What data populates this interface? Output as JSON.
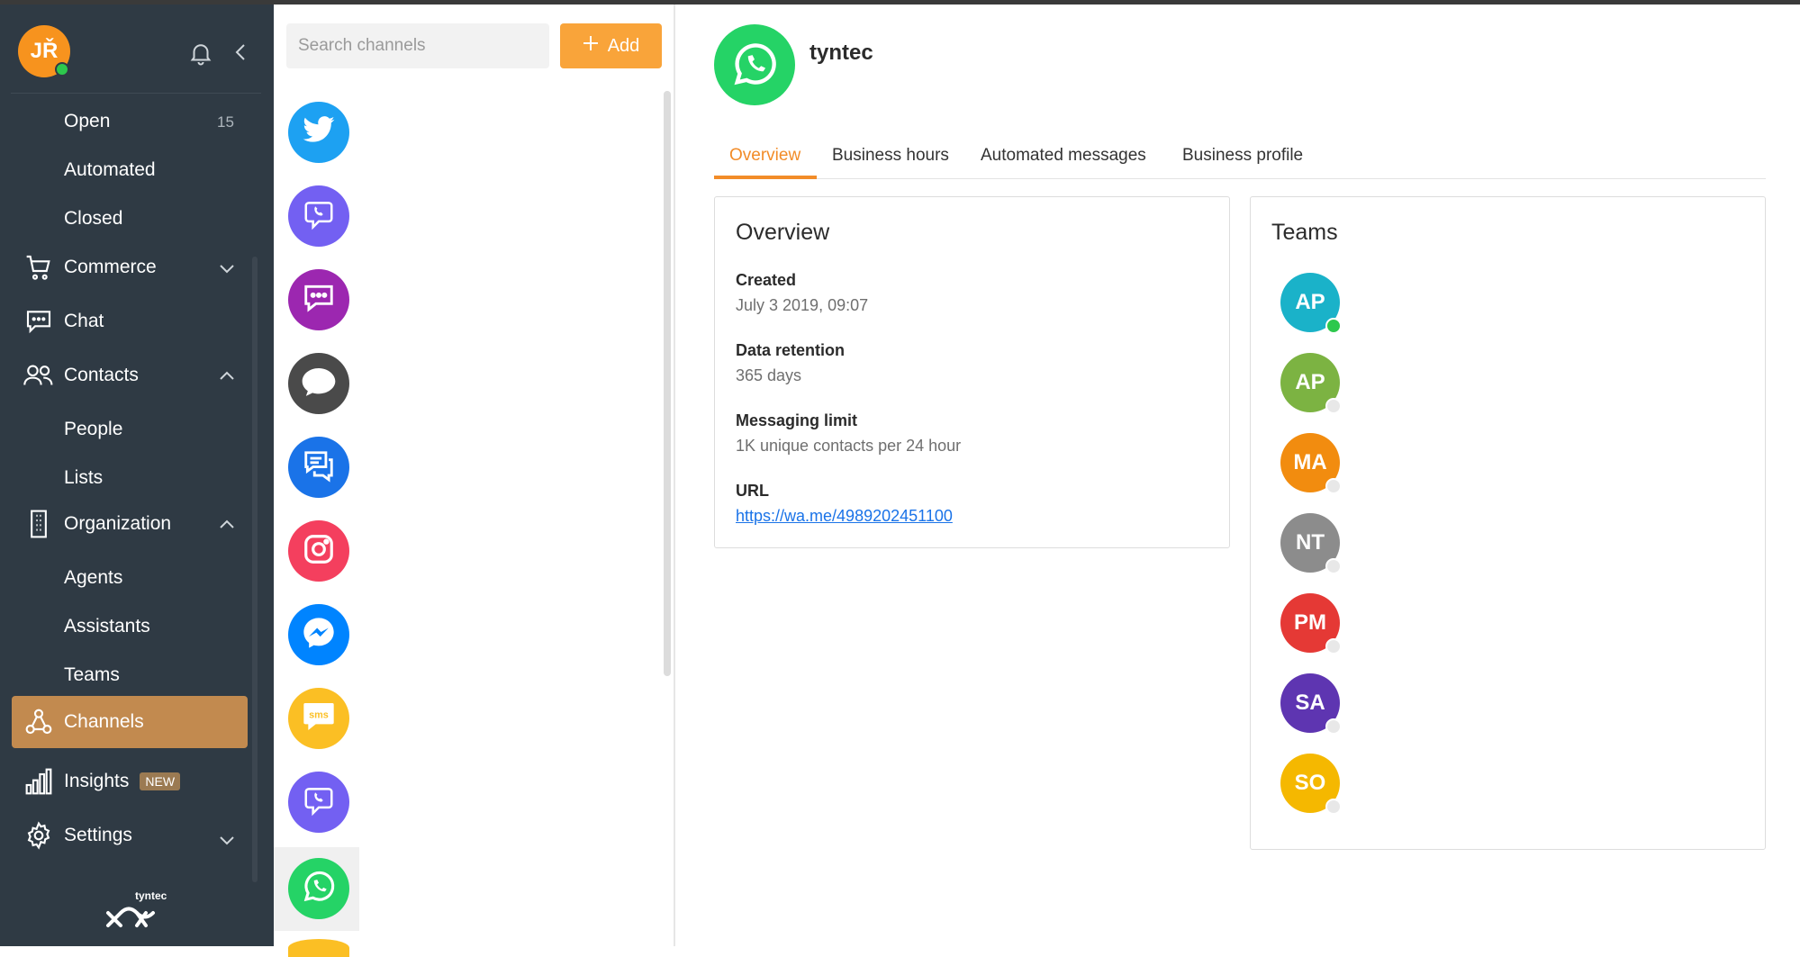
{
  "user": {
    "initials": "JŘ",
    "status_color": "#2dc84d"
  },
  "sidebar": {
    "sub_top": [
      {
        "label": "Open",
        "count": "15"
      },
      {
        "label": "Automated"
      },
      {
        "label": "Closed"
      }
    ],
    "commerce": {
      "label": "Commerce",
      "icon": "cart-icon"
    },
    "chat": {
      "label": "Chat",
      "icon": "chat-bubble-icon"
    },
    "contacts": {
      "label": "Contacts",
      "icon": "people-icon",
      "children": [
        "People",
        "Lists"
      ]
    },
    "organization": {
      "label": "Organization",
      "icon": "building-icon",
      "children": [
        "Agents",
        "Assistants",
        "Teams"
      ]
    },
    "channels": {
      "label": "Channels",
      "icon": "channels-hub-icon"
    },
    "insights": {
      "label": "Insights",
      "badge": "NEW",
      "icon": "bar-chart-icon"
    },
    "settings": {
      "label": "Settings",
      "icon": "gear-icon"
    },
    "brand": "tyntec",
    "colors": {
      "bg": "#2f3a44",
      "active": "#c28a4f"
    }
  },
  "channel_list": {
    "search_placeholder": "Search channels",
    "add_label": "Add",
    "channels": [
      {
        "icon": "twitter-icon",
        "color": "#1da1f2"
      },
      {
        "icon": "viber-icon",
        "color": "#7360f2"
      },
      {
        "icon": "chat-dots-icon",
        "color": "#9c27b0"
      },
      {
        "icon": "speech-bubble-icon",
        "color": "#4a4a4a"
      },
      {
        "icon": "messages-icon",
        "color": "#1a73e8"
      },
      {
        "icon": "instagram-icon",
        "color": "#f43f5e"
      },
      {
        "icon": "messenger-icon",
        "color": "#0084ff"
      },
      {
        "icon": "sms-icon",
        "color": "#fbbf24"
      },
      {
        "icon": "viber-icon",
        "color": "#7360f2"
      },
      {
        "icon": "whatsapp-icon",
        "color": "#25d366",
        "selected": true
      }
    ]
  },
  "channel": {
    "name": "tyntec",
    "icon": "whatsapp-icon",
    "tabs": [
      "Overview",
      "Business hours",
      "Automated messages",
      "Business profile"
    ],
    "active_tab": "Overview",
    "overview": {
      "title": "Overview",
      "created_label": "Created",
      "created_value": "July 3 2019, 09:07",
      "retention_label": "Data retention",
      "retention_value": "365 days",
      "limit_label": "Messaging limit",
      "limit_value": "1K unique contacts per 24 hour",
      "url_label": "URL",
      "url_value": "https://wa.me/4989202451100"
    },
    "teams": {
      "title": "Teams",
      "members": [
        {
          "initials": "AP",
          "color": "#1ab2c9",
          "online": true
        },
        {
          "initials": "AP",
          "color": "#7cb342",
          "online": false
        },
        {
          "initials": "MA",
          "color": "#f28c0f",
          "online": false
        },
        {
          "initials": "NT",
          "color": "#8c8c8c",
          "online": false
        },
        {
          "initials": "PM",
          "color": "#e53935",
          "online": false
        },
        {
          "initials": "SA",
          "color": "#5e35b1",
          "online": false
        },
        {
          "initials": "SO",
          "color": "#f5b800",
          "online": false
        }
      ]
    }
  }
}
